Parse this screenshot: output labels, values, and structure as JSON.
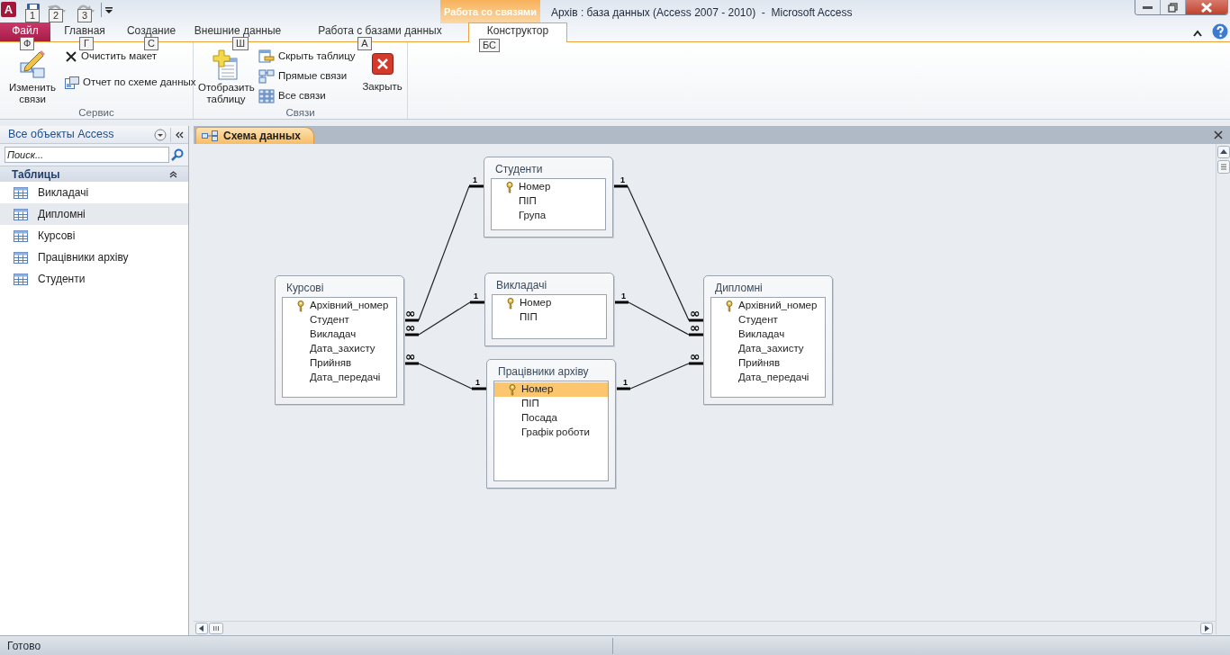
{
  "window": {
    "app_icon": "A",
    "title": "Архів : база данных (Access 2007 - 2010)  -  Microsoft Access"
  },
  "quick_access": [
    {
      "kind": "save",
      "keytip": "1",
      "disabled": false
    },
    {
      "kind": "undo",
      "keytip": "2",
      "disabled": true
    },
    {
      "kind": "redo",
      "keytip": "3",
      "disabled": true
    }
  ],
  "contextual_tab_group": "Работа со связями",
  "tabs": [
    {
      "label": "Файл",
      "kind": "file",
      "keytip": "Ф",
      "selected": false
    },
    {
      "label": "Главная",
      "kind": "tab",
      "keytip": "Г",
      "selected": false
    },
    {
      "label": "Создание",
      "kind": "tab",
      "keytip": "С",
      "selected": false
    },
    {
      "label": "Внешние данные",
      "kind": "tab",
      "keytip": "Ш",
      "selected": false
    },
    {
      "label": "Работа с базами данных",
      "kind": "tab",
      "keytip": "А",
      "selected": false
    },
    {
      "label": "Конструктор",
      "kind": "contextual",
      "keytip": "БС",
      "selected": true
    }
  ],
  "ribbon_groups": [
    {
      "label": "Сервис",
      "commands": [
        {
          "kind": "large",
          "label": "Изменить связи"
        },
        {
          "kind": "small",
          "label": "Очистить макет"
        },
        {
          "kind": "small",
          "label": "Отчет по схеме данных"
        }
      ]
    },
    {
      "label": "Связи",
      "commands": [
        {
          "kind": "large",
          "label": "Отобразить таблицу"
        },
        {
          "kind": "small",
          "label": "Скрыть таблицу"
        },
        {
          "kind": "small",
          "label": "Прямые связи"
        },
        {
          "kind": "small",
          "label": "Все связи"
        },
        {
          "kind": "large",
          "label": "Закрыть"
        }
      ]
    }
  ],
  "navigation_pane": {
    "title": "Все объекты Access",
    "search": {
      "placeholder": "Поиск..."
    },
    "group": "Таблицы",
    "items": [
      {
        "label": "Викладачі",
        "selected": false
      },
      {
        "label": "Дипломні",
        "selected": true
      },
      {
        "label": "Курсові",
        "selected": false
      },
      {
        "label": "Працівники архіву",
        "selected": false
      },
      {
        "label": "Студенти",
        "selected": false
      }
    ]
  },
  "document_tab": {
    "label": "Схема данных"
  },
  "diagram": {
    "tables": [
      {
        "title": "Студенти",
        "fields": [
          {
            "name": "Номер",
            "primary_key": true,
            "selected": false
          },
          {
            "name": "ПІП",
            "primary_key": false,
            "selected": false
          },
          {
            "name": "Група",
            "primary_key": false,
            "selected": false
          }
        ]
      },
      {
        "title": "Курсові",
        "fields": [
          {
            "name": "Архівний_номер",
            "primary_key": true,
            "selected": false
          },
          {
            "name": "Студент",
            "primary_key": false,
            "selected": false
          },
          {
            "name": "Викладач",
            "primary_key": false,
            "selected": false
          },
          {
            "name": "Дата_захисту",
            "primary_key": false,
            "selected": false
          },
          {
            "name": "Прийняв",
            "primary_key": false,
            "selected": false
          },
          {
            "name": "Дата_передачі",
            "primary_key": false,
            "selected": false
          }
        ]
      },
      {
        "title": "Викладачі",
        "fields": [
          {
            "name": "Номер",
            "primary_key": true,
            "selected": false
          },
          {
            "name": "ПІП",
            "primary_key": false,
            "selected": false
          }
        ]
      },
      {
        "title": "Дипломні",
        "fields": [
          {
            "name": "Архівний_номер",
            "primary_key": true,
            "selected": false
          },
          {
            "name": "Студент",
            "primary_key": false,
            "selected": false
          },
          {
            "name": "Викладач",
            "primary_key": false,
            "selected": false
          },
          {
            "name": "Дата_захисту",
            "primary_key": false,
            "selected": false
          },
          {
            "name": "Прийняв",
            "primary_key": false,
            "selected": false
          },
          {
            "name": "Дата_передачі",
            "primary_key": false,
            "selected": false
          }
        ]
      },
      {
        "title": "Працівники архіву",
        "fields": [
          {
            "name": "Номер",
            "primary_key": true,
            "selected": true
          },
          {
            "name": "ПІП",
            "primary_key": false,
            "selected": false
          },
          {
            "name": "Посада",
            "primary_key": false,
            "selected": false
          },
          {
            "name": "Графік роботи",
            "primary_key": false,
            "selected": false
          }
        ]
      }
    ],
    "relationships": [
      {
        "one": "1",
        "many": "∞"
      },
      {
        "one": "1",
        "many": "∞"
      },
      {
        "one": "1",
        "many": "∞"
      },
      {
        "one": "1",
        "many": "∞"
      },
      {
        "one": "1",
        "many": "∞"
      },
      {
        "one": "1",
        "many": "∞"
      }
    ]
  },
  "status_bar": {
    "text": "Готово"
  }
}
